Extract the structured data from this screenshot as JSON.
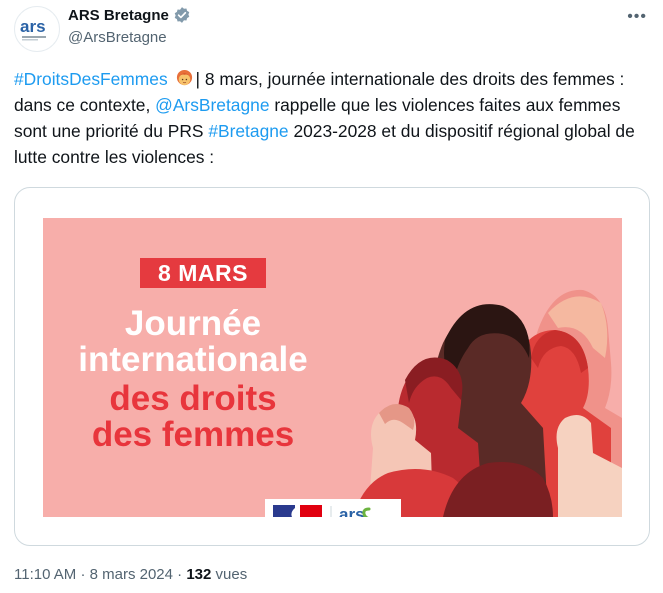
{
  "author": {
    "name": "ARS Bretagne",
    "handle": "@ArsBretagne",
    "avatar_text": "ars",
    "verified_icon": "verified-badge-icon"
  },
  "tweet": {
    "hashtag1": "#DroitsDesFemmes",
    "text1": "| 8 mars, journée internationale des droits des femmes : dans ce contexte,",
    "mention": "@ArsBretagne",
    "text2": "rappelle que les violences faites aux femmes sont une priorité du PRS",
    "hashtag2": "#Bretagne",
    "text3": "2023-2028 et du dispositif régional global de lutte contre les violences :"
  },
  "poster": {
    "date_badge": "8 MARS",
    "line1": "Journée",
    "line2": "internationale",
    "line3": "des droits",
    "line4": "des femmes",
    "logo_text": "ars"
  },
  "footer": {
    "time": "11:10 AM",
    "date": "8 mars 2024",
    "views_count": "132",
    "views_label": "vues"
  },
  "colors": {
    "link": "#1d9bf0",
    "poster_bg": "#f7aeaa",
    "accent_red": "#e53a3f",
    "ars_green": "#6cb33f",
    "ars_blue": "#2a62a6"
  }
}
